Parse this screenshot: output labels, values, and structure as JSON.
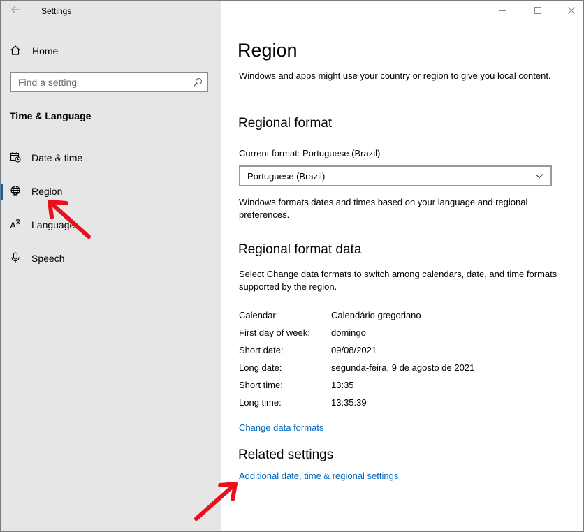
{
  "window": {
    "title": "Settings",
    "controls": [
      "minimize",
      "maximize",
      "close"
    ]
  },
  "sidebar": {
    "home_label": "Home",
    "search_placeholder": "Find a setting",
    "section_heading": "Time & Language",
    "items": [
      {
        "label": "Date & time",
        "icon": "calendar-clock-icon",
        "selected": false
      },
      {
        "label": "Region",
        "icon": "globe-icon",
        "selected": true
      },
      {
        "label": "Language",
        "icon": "language-icon",
        "selected": false
      },
      {
        "label": "Speech",
        "icon": "microphone-icon",
        "selected": false
      }
    ]
  },
  "main": {
    "title": "Region",
    "intro": "Windows and apps might use your country or region to give you local content.",
    "regional_format": {
      "heading": "Regional format",
      "current_label": "Current format: Portuguese (Brazil)",
      "selected_value": "Portuguese (Brazil)",
      "note": "Windows formats dates and times based on your language and regional preferences."
    },
    "regional_format_data": {
      "heading": "Regional format data",
      "description": "Select Change data formats to switch among calendars, date, and time formats supported by the region.",
      "rows": [
        {
          "key": "Calendar:",
          "value": "Calendário gregoriano"
        },
        {
          "key": "First day of week:",
          "value": "domingo"
        },
        {
          "key": "Short date:",
          "value": "09/08/2021"
        },
        {
          "key": "Long date:",
          "value": "segunda-feira, 9 de agosto de 2021"
        },
        {
          "key": "Short time:",
          "value": "13:35"
        },
        {
          "key": "Long time:",
          "value": "13:35:39"
        }
      ],
      "change_link": "Change data formats"
    },
    "related": {
      "heading": "Related settings",
      "link": "Additional date, time & regional settings"
    }
  },
  "colors": {
    "accent": "#0063b1",
    "link": "#0067c0",
    "sidebar_bg": "#e6e6e6",
    "annotation_arrow": "#e8101a"
  }
}
